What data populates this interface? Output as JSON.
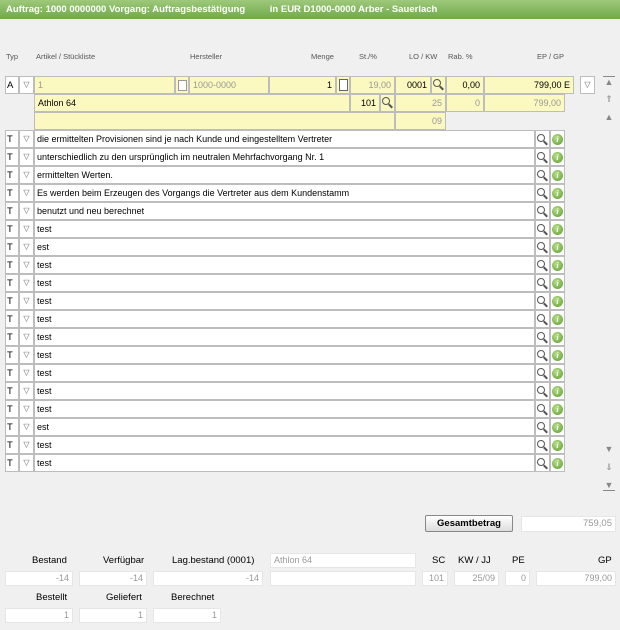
{
  "title": {
    "left": "Auftrag: 1000 0000000 Vorgang: Auftragsbestätigung",
    "right": "in EUR D1000-0000 Arber - Sauerlach"
  },
  "columns": {
    "typ": "Typ",
    "artikel": "Artikel / Stückliste",
    "hersteller": "Hersteller",
    "menge": "Menge",
    "st": "St./%",
    "lo_kw": "LO / KW",
    "rab": "Rab. %",
    "ep_gp": "EP / GP"
  },
  "article_row": {
    "typ": "A",
    "artikel": "1",
    "hersteller": "1000-0000",
    "menge": "1",
    "st": "19,00",
    "lo": "0001",
    "rab": "0,00",
    "ep": "799,00",
    "ep_unit": "E",
    "name": "Athlon 64",
    "menge2": "101",
    "kw": "25",
    "rab2": "0",
    "gp": "799,00",
    "jj": "09"
  },
  "text_rows": [
    {
      "typ": "T",
      "text": "die ermittelten Provisionen sind je nach Kunde und eingestelltem Vertreter"
    },
    {
      "typ": "T",
      "text": "unterschiedlich zu den ursprünglich im neutralen Mehrfachvorgang Nr. 1"
    },
    {
      "typ": "T",
      "text": "ermittelten Werten."
    },
    {
      "typ": "T",
      "text": "Es werden beim Erzeugen des Vorgangs die Vertreter aus dem Kundenstamm"
    },
    {
      "typ": "T",
      "text": "benutzt und neu berechnet"
    },
    {
      "typ": "T",
      "text": "test"
    },
    {
      "typ": "T",
      "text": "est"
    },
    {
      "typ": "T",
      "text": "test"
    },
    {
      "typ": "T",
      "text": "test"
    },
    {
      "typ": "T",
      "text": "test"
    },
    {
      "typ": "T",
      "text": "test"
    },
    {
      "typ": "T",
      "text": "test"
    },
    {
      "typ": "T",
      "text": "test"
    },
    {
      "typ": "T",
      "text": "test"
    },
    {
      "typ": "T",
      "text": "test"
    },
    {
      "typ": "T",
      "text": "test"
    },
    {
      "typ": "T",
      "text": "est"
    },
    {
      "typ": "T",
      "text": "test"
    },
    {
      "typ": "T",
      "text": "test"
    }
  ],
  "info_glyph": "i",
  "gesamt": {
    "label": "Gesamtbetrag",
    "value": "759,05"
  },
  "stock": {
    "bestand_label": "Bestand",
    "bestand": "-14",
    "verfuegbar_label": "Verfügbar",
    "verfuegbar": "-14",
    "lagbestand_label": "Lag.bestand (0001)",
    "lagbestand": "-14",
    "article_name": "Athlon 64",
    "sc_label": "SC",
    "sc": "101",
    "kwjj_label": "KW / JJ",
    "kwjj": "25/09",
    "pe_label": "PE",
    "pe": "0",
    "gp_label": "GP",
    "gp": "799,00",
    "bestellt_label": "Bestellt",
    "bestellt": "1",
    "geliefert_label": "Geliefert",
    "geliefert": "1",
    "berechnet_label": "Berechnet",
    "berechnet": "1"
  },
  "icons": [
    "search-icon",
    "info-icon",
    "dropdown-arrow-icon",
    "document-icon",
    "scroll-top-icon",
    "scroll-up-icon",
    "scroll-down-icon",
    "scroll-bottom-icon"
  ]
}
